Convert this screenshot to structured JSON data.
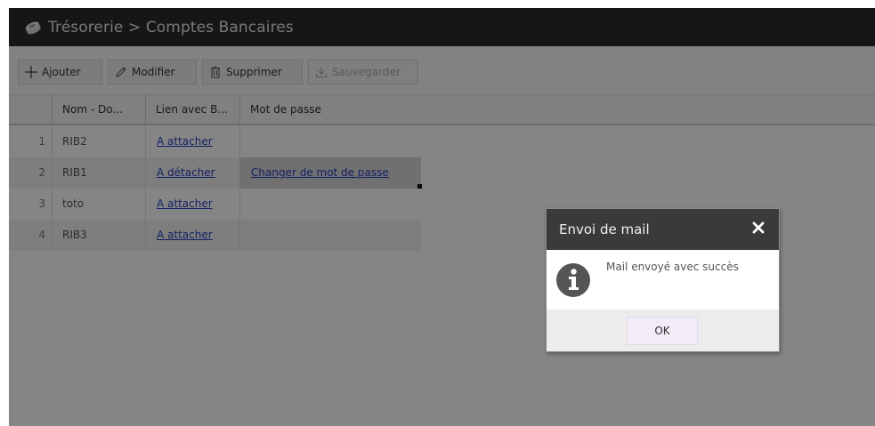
{
  "header": {
    "title": "Trésorerie > Comptes Bancaires",
    "logo_icon": "coins-icon"
  },
  "toolbar": {
    "add_label": "Ajouter",
    "edit_label": "Modifier",
    "delete_label": "Supprimer",
    "save_label": "Sauvegarder"
  },
  "table": {
    "columns": [
      "",
      "Nom - Do...",
      "Lien avec B...",
      "Mot de passe"
    ],
    "rows": [
      {
        "num": "1",
        "nom": "RIB2",
        "lien": "A attacher",
        "mdp": ""
      },
      {
        "num": "2",
        "nom": "RIB1",
        "lien": "A détacher",
        "mdp": "Changer de mot de passe"
      },
      {
        "num": "3",
        "nom": "toto",
        "lien": "A attacher",
        "mdp": ""
      },
      {
        "num": "4",
        "nom": "RIB3",
        "lien": "A attacher",
        "mdp": ""
      }
    ]
  },
  "dialog": {
    "title": "Envoi de mail",
    "message": "Mail envoyé avec succès",
    "ok_label": "OK",
    "icon": "info-icon"
  },
  "colors": {
    "header_bg": "#2b2b2b",
    "link": "#2a3fbf",
    "dialog_header_bg": "#3a3a3a",
    "ok_button_bg": "#f1ecf7"
  }
}
